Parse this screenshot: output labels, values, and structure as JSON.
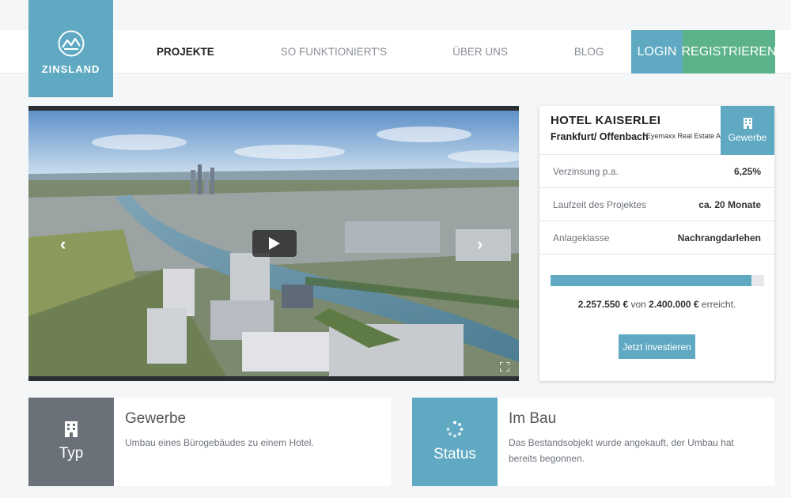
{
  "brand": {
    "name": "ZINSLAND",
    "color": "#5fa9c2"
  },
  "nav": [
    {
      "label": "PROJEKTE",
      "active": true
    },
    {
      "label": "SO FUNKTIONIERT'S",
      "active": false
    },
    {
      "label": "ÜBER UNS",
      "active": false
    },
    {
      "label": "BLOG",
      "active": false
    }
  ],
  "auth": {
    "login": "LOGIN",
    "register": "REGISTRIEREN",
    "register_color": "#5cb38a"
  },
  "video": {
    "play_icon": "play-icon",
    "prev_icon": "chevron-left-icon",
    "next_icon": "chevron-right-icon",
    "fullscreen_icon": "fullscreen-icon"
  },
  "project": {
    "title": "HOTEL KAISERLEI",
    "location": "Frankfurt/ Offenbach",
    "company": "Eyemaxx Real Estate AG",
    "type": "Gewerbe",
    "details": [
      {
        "label": "Verzinsung p.a.",
        "value": "6,25%"
      },
      {
        "label": "Laufzeit des Projektes",
        "value": "ca. 20 Monate"
      },
      {
        "label": "Anlageklasse",
        "value": "Nachrangdarlehen"
      }
    ],
    "funding": {
      "raised": "2.257.550 €",
      "von": "von",
      "goal": "2.400.000 €",
      "suffix": "erreicht.",
      "progress": 0.94
    },
    "cta": "Jetzt investieren"
  },
  "info_boxes": [
    {
      "tile_label": "Typ",
      "title": "Gewerbe",
      "desc": "Umbau eines Bürogebäudes zu einem Hotel.",
      "color": "#6b7178",
      "icon": "building-icon"
    },
    {
      "tile_label": "Status",
      "title": "Im Bau",
      "desc": "Das Bestandsobjekt wurde angekauft, der Umbau hat bereits begonnen.",
      "color": "#5fa9c2",
      "icon": "loading-icon"
    }
  ]
}
